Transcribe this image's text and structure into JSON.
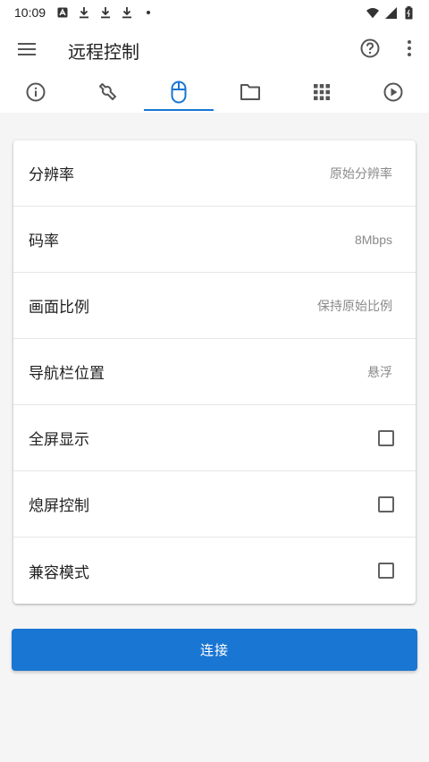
{
  "status_bar": {
    "time": "10:09",
    "left_icons": [
      "auto-icon",
      "download-icon",
      "download-icon",
      "download-icon",
      "dot-icon"
    ],
    "right_icons": [
      "wifi-icon",
      "signal-icon",
      "battery-icon"
    ]
  },
  "app_bar": {
    "title": "远程控制",
    "menu_icon": "menu-icon",
    "help_icon": "help-icon",
    "more_icon": "more-vert-icon"
  },
  "tabs": [
    {
      "icon": "info-icon",
      "active": false
    },
    {
      "icon": "wrench-icon",
      "active": true
    },
    {
      "icon": "mouse-icon",
      "active": true
    },
    {
      "icon": "folder-icon",
      "active": false
    },
    {
      "icon": "apps-grid-icon",
      "active": false
    },
    {
      "icon": "play-circle-icon",
      "active": false
    }
  ],
  "settings": [
    {
      "label": "分辨率",
      "value": "原始分辨率"
    },
    {
      "label": "码率",
      "value": "8Mbps"
    },
    {
      "label": "画面比例",
      "value": "保持原始比例"
    },
    {
      "label": "导航栏位置",
      "value": "悬浮"
    },
    {
      "label": "全屏显示",
      "checked": false
    },
    {
      "label": "熄屏控制",
      "checked": false
    },
    {
      "label": "兼容模式",
      "checked": false
    }
  ],
  "connect_label": "连接",
  "colors": {
    "accent": "#1976d2",
    "background": "#f5f5f5",
    "icon": "#616161"
  }
}
